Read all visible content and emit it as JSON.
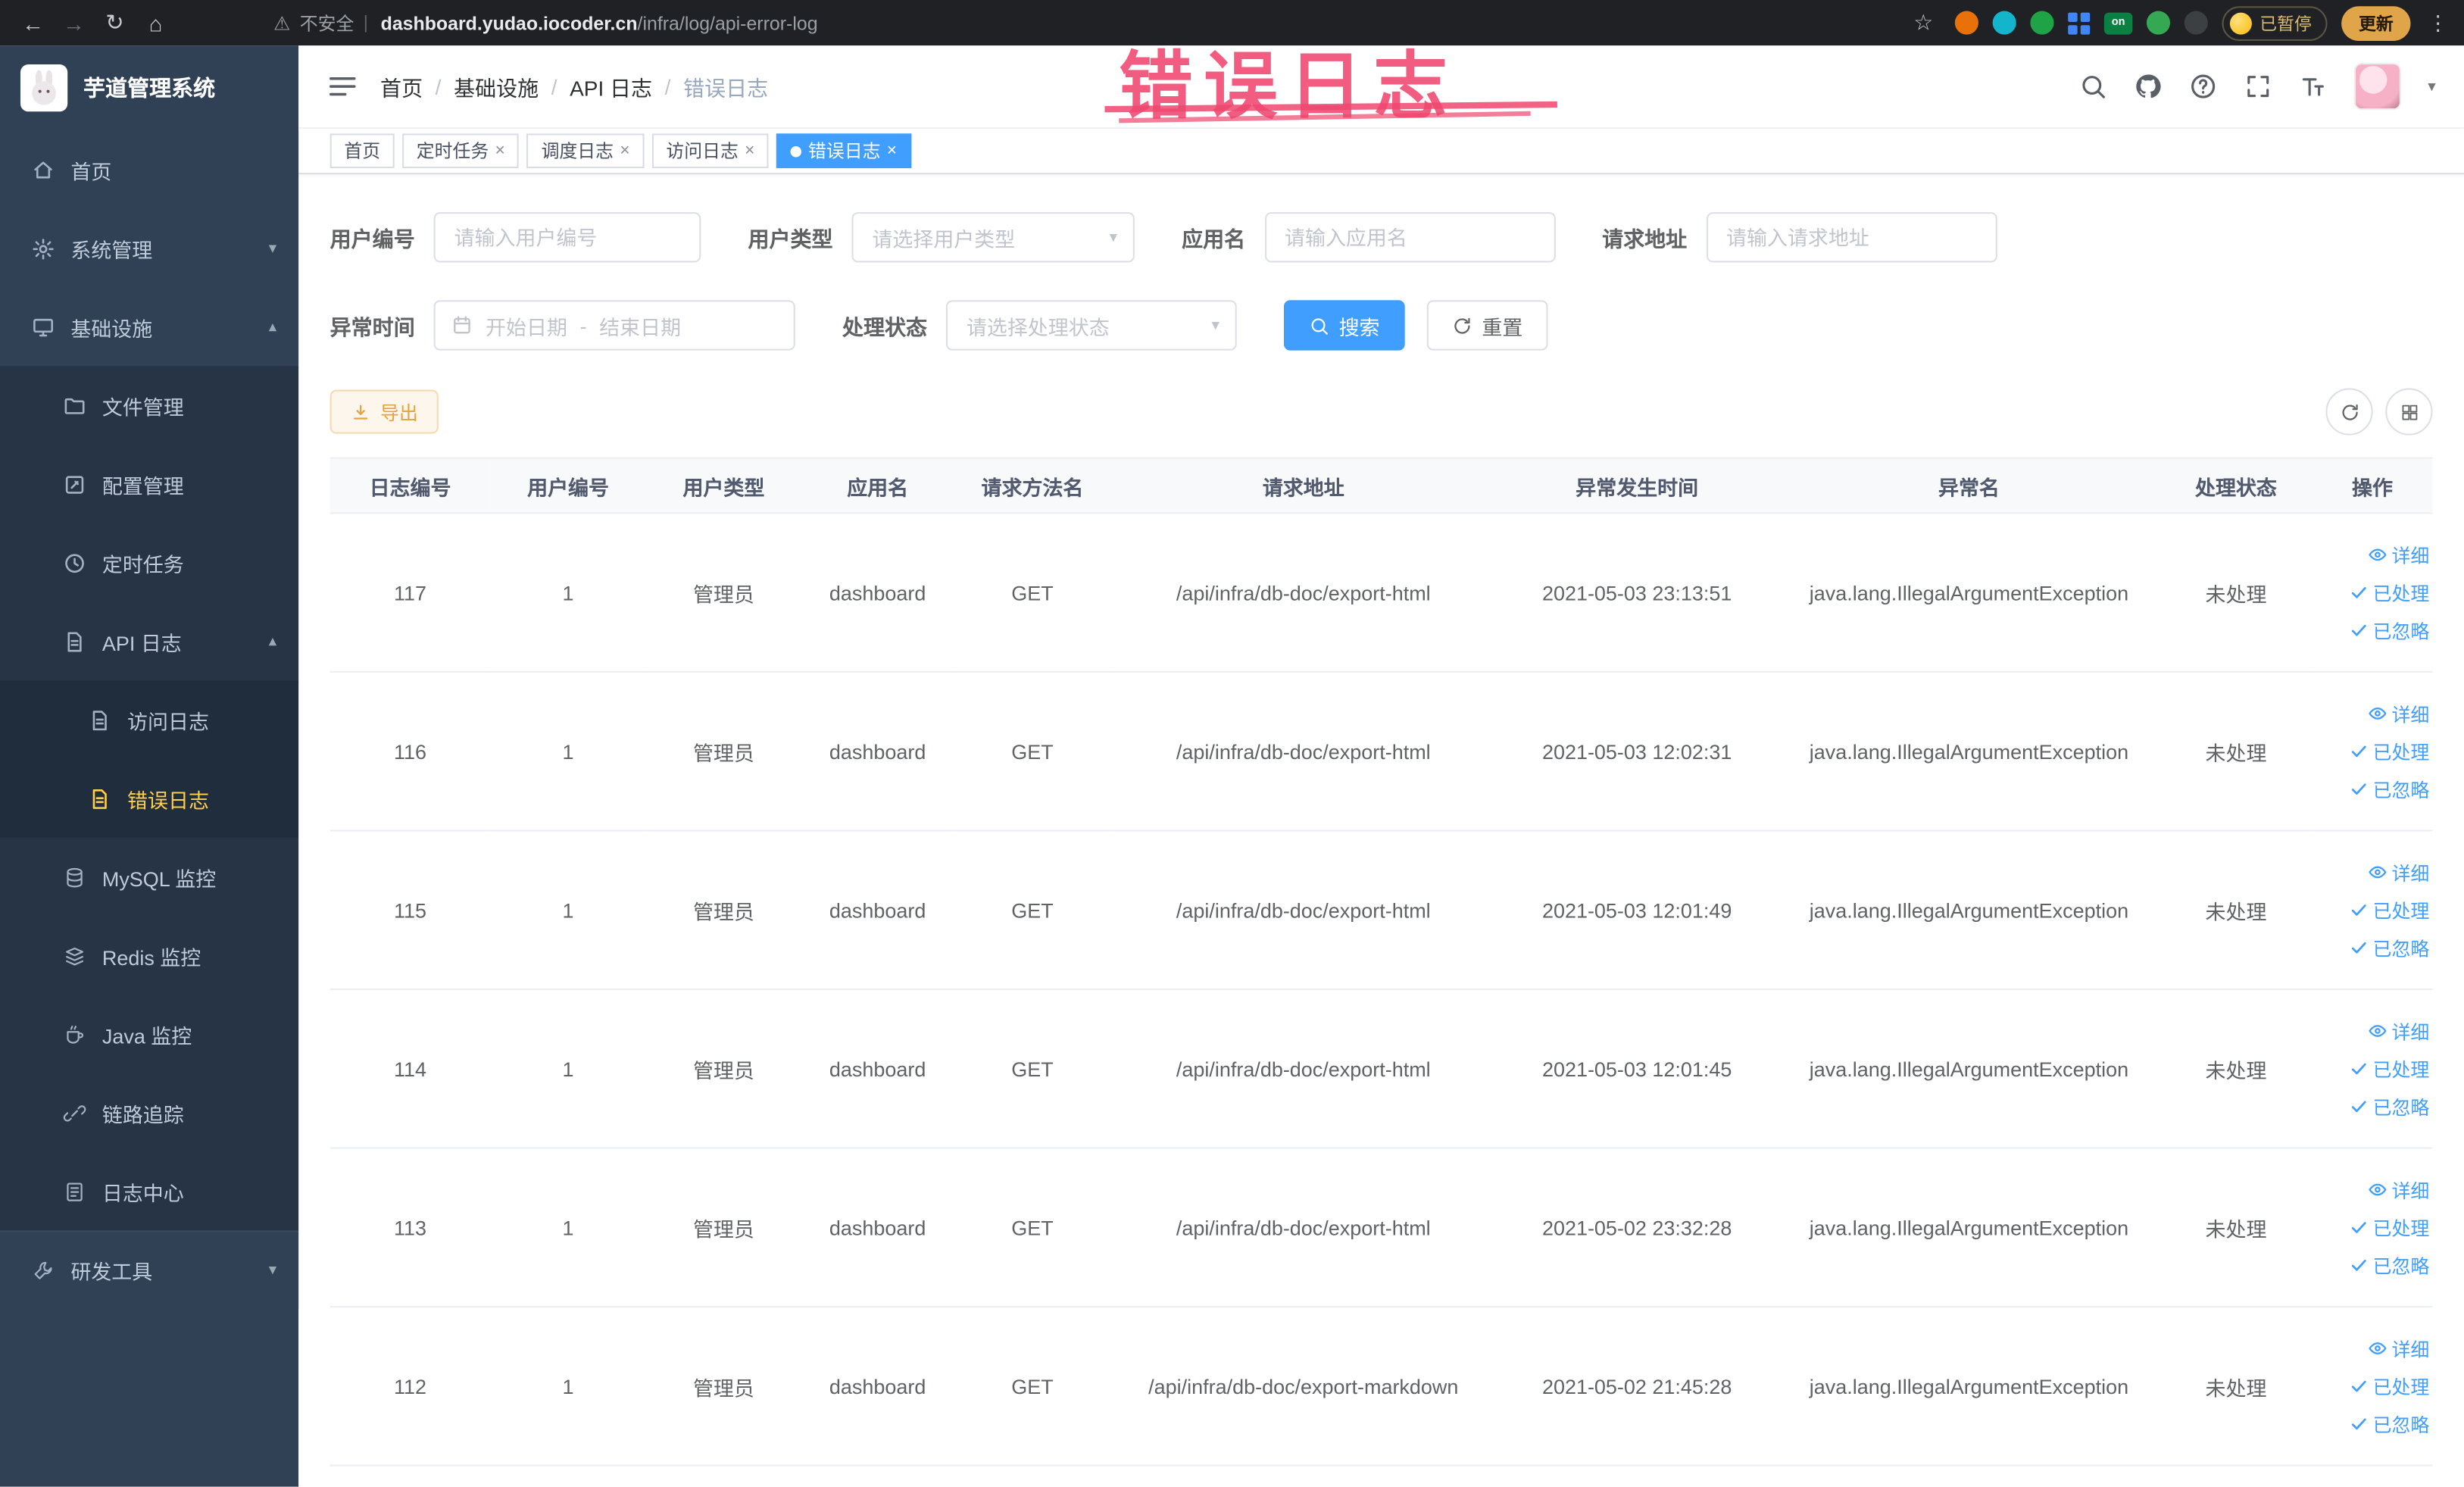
{
  "colors": {
    "accent": "#409EFF",
    "sidebar_bg": "#304156",
    "sidebar_submenu_bg": "#1f2d3d",
    "active_menu_text": "#ffd04b",
    "warning": "#e6a23c",
    "annotation_pink": "#ef466e",
    "browser_bar_bg": "#202124"
  },
  "icons": {
    "back": "←",
    "forward": "→",
    "reload": "↻",
    "home": "⌂",
    "warning": "⚠",
    "divider": "|",
    "star": "☆",
    "kebab": "⋮",
    "close": "×",
    "caret_down": "▾",
    "arrow_down": "▾",
    "arrow_up": "▴",
    "separator": "/"
  },
  "browser": {
    "security_label": "不安全",
    "url_domain": "dashboard.yudao.iocoder.cn",
    "url_path": "/infra/log/api-error-log",
    "ext_on_label": "on",
    "paused_badge": "已暂停",
    "update_button": "更新"
  },
  "annotation": {
    "watermark": "错误日志"
  },
  "sidebar": {
    "logo_title": "芋道管理系统",
    "items": [
      {
        "label": "首页",
        "icon": "home-icon"
      },
      {
        "label": "系统管理",
        "icon": "gear-icon"
      },
      {
        "label": "基础设施",
        "icon": "monitor-icon"
      },
      {
        "label": "文件管理",
        "icon": "folder-icon"
      },
      {
        "label": "配置管理",
        "icon": "edit-icon"
      },
      {
        "label": "定时任务",
        "icon": "clock-icon"
      },
      {
        "label": "API 日志",
        "icon": "doc-icon"
      },
      {
        "label": "访问日志",
        "icon": "doc-icon"
      },
      {
        "label": "错误日志",
        "icon": "doc-icon",
        "active": true
      },
      {
        "label": "MySQL 监控",
        "icon": "database-icon"
      },
      {
        "label": "Redis 监控",
        "icon": "redis-icon"
      },
      {
        "label": "Java 监控",
        "icon": "java-icon"
      },
      {
        "label": "链路追踪",
        "icon": "link-icon"
      },
      {
        "label": "日志中心",
        "icon": "log-icon"
      },
      {
        "label": "研发工具",
        "icon": "tool-icon"
      }
    ]
  },
  "header": {
    "breadcrumb": [
      "首页",
      "基础设施",
      "API 日志",
      "错误日志"
    ],
    "separator": "/"
  },
  "tabs": [
    {
      "label": "首页",
      "closable": false
    },
    {
      "label": "定时任务",
      "closable": true
    },
    {
      "label": "调度日志",
      "closable": true
    },
    {
      "label": "访问日志",
      "closable": true
    },
    {
      "label": "错误日志",
      "closable": true,
      "active": true
    }
  ],
  "filters": {
    "user_id": {
      "label": "用户编号",
      "placeholder": "请输入用户编号"
    },
    "user_type": {
      "label": "用户类型",
      "placeholder": "请选择用户类型"
    },
    "app_name": {
      "label": "应用名",
      "placeholder": "请输入应用名"
    },
    "request_url": {
      "label": "请求地址",
      "placeholder": "请输入请求地址"
    },
    "exception_time": {
      "label": "异常时间",
      "start_placeholder": "开始日期",
      "separator": "-",
      "end_placeholder": "结束日期"
    },
    "process_status": {
      "label": "处理状态",
      "placeholder": "请选择处理状态"
    },
    "search_button": "搜索",
    "reset_button": "重置"
  },
  "toolbar": {
    "export_button": "导出"
  },
  "table": {
    "columns": [
      "日志编号",
      "用户编号",
      "用户类型",
      "应用名",
      "请求方法名",
      "请求地址",
      "异常发生时间",
      "异常名",
      "处理状态",
      "操作"
    ],
    "action_labels": {
      "detail": "详细",
      "processed": "已处理",
      "ignored": "已忽略"
    },
    "rows": [
      {
        "id": "117",
        "user_id": "1",
        "user_type": "管理员",
        "app": "dashboard",
        "method": "GET",
        "url": "/api/infra/db-doc/export-html",
        "time": "2021-05-03 23:13:51",
        "exception": "java.lang.IllegalArgumentException",
        "status": "未处理"
      },
      {
        "id": "116",
        "user_id": "1",
        "user_type": "管理员",
        "app": "dashboard",
        "method": "GET",
        "url": "/api/infra/db-doc/export-html",
        "time": "2021-05-03 12:02:31",
        "exception": "java.lang.IllegalArgumentException",
        "status": "未处理"
      },
      {
        "id": "115",
        "user_id": "1",
        "user_type": "管理员",
        "app": "dashboard",
        "method": "GET",
        "url": "/api/infra/db-doc/export-html",
        "time": "2021-05-03 12:01:49",
        "exception": "java.lang.IllegalArgumentException",
        "status": "未处理"
      },
      {
        "id": "114",
        "user_id": "1",
        "user_type": "管理员",
        "app": "dashboard",
        "method": "GET",
        "url": "/api/infra/db-doc/export-html",
        "time": "2021-05-03 12:01:45",
        "exception": "java.lang.IllegalArgumentException",
        "status": "未处理"
      },
      {
        "id": "113",
        "user_id": "1",
        "user_type": "管理员",
        "app": "dashboard",
        "method": "GET",
        "url": "/api/infra/db-doc/export-html",
        "time": "2021-05-02 23:32:28",
        "exception": "java.lang.IllegalArgumentException",
        "status": "未处理"
      },
      {
        "id": "112",
        "user_id": "1",
        "user_type": "管理员",
        "app": "dashboard",
        "method": "GET",
        "url": "/api/infra/db-doc/export-markdown",
        "time": "2021-05-02 21:45:28",
        "exception": "java.lang.IllegalArgumentException",
        "status": "未处理"
      }
    ]
  }
}
